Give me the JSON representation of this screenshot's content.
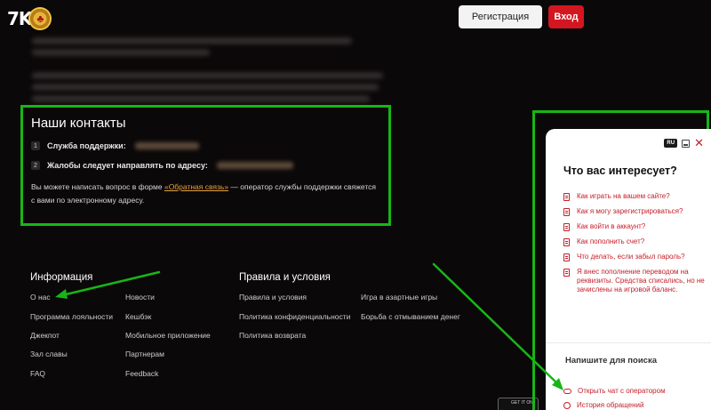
{
  "header": {
    "logo_text": "7K",
    "logo_chip_glyph": "♣",
    "register_label": "Регистрация",
    "login_label": "Вход"
  },
  "contacts": {
    "title": "Наши контакты",
    "items": [
      {
        "num": "1",
        "label": "Служба поддержки:"
      },
      {
        "num": "2",
        "label": "Жалобы следует направлять по адресу:"
      }
    ],
    "text_before": "Вы можете написать вопрос в форме ",
    "link": "«Обратная связь»",
    "text_after": " — оператор службы поддержки свяжется с вами по электронному адресу."
  },
  "footer": {
    "info_title": "Информация",
    "info_col1": [
      "О нас",
      "Программа лояльности",
      "Джекпот",
      "Зал славы",
      "FAQ"
    ],
    "info_col2": [
      "Новости",
      "Кешбэк",
      "Мобильное приложение",
      "Партнерам",
      "Feedback"
    ],
    "rules_title": "Правила и условия",
    "rules_col1": [
      "Правила и условия",
      "Политика конфиденциальности",
      "Политика возврата"
    ],
    "rules_col2": [
      "Игра в азартные игры",
      "Борьба с отмыванием денег"
    ],
    "store_badge": "GET IT ON"
  },
  "widget": {
    "lang": "RU",
    "title": "Что вас интересует?",
    "questions": [
      "Как играть на вашем сайте?",
      "Как я могу зарегистрироваться?",
      "Как войти в аккаунт?",
      "Как пополнить счет?",
      "Что делать, если забыл пароль?",
      "Я внес пополнение переводом на реквизиты. Средства списались, но не зачислены на игровой баланс."
    ],
    "search_prompt": "Напишите для поиска",
    "open_chat": "Открыть чат с оператором",
    "history": "История обращений"
  },
  "colors": {
    "background": "#0b0809",
    "accent_red": "#d3161f",
    "highlight_green": "#17b617",
    "link_orange": "#e6a13a"
  }
}
